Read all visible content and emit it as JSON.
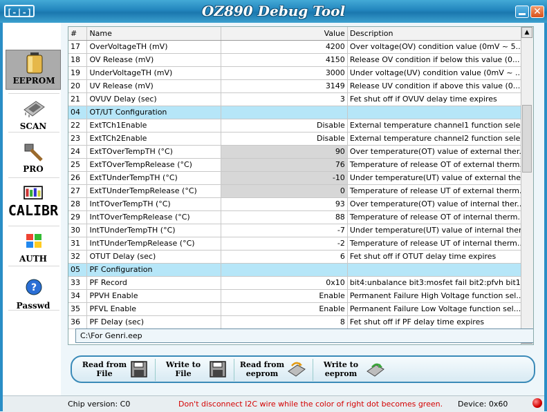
{
  "window": {
    "title": "OZ890 Debug Tool",
    "logo_text": "[-|-]",
    "close_glyph": "✕"
  },
  "sidebar": {
    "items": [
      {
        "label": "EEPROM",
        "icon": "battery-icon",
        "active": true
      },
      {
        "label": "SCAN",
        "icon": "chip-icon",
        "active": false
      },
      {
        "label": "PRO",
        "icon": "hammer-icon",
        "active": false
      },
      {
        "label": "CALIBR",
        "icon": "calibrate-icon",
        "active": false
      },
      {
        "label": "AUTH",
        "icon": "windows-flag-icon",
        "active": false
      },
      {
        "label": "Passwd",
        "icon": "help-icon",
        "active": false
      }
    ]
  },
  "grid": {
    "columns": [
      "#",
      "Name",
      "Value",
      "Description"
    ],
    "rows": [
      {
        "n": "17",
        "name": "OverVoltageTH (mV)",
        "value": "4200",
        "desc": "Over voltage(OV) condition value (0mV ~ 5...",
        "section": false,
        "grey": false
      },
      {
        "n": "18",
        "name": "OV Release (mV)",
        "value": "4150",
        "desc": "Release OV condition if below this value (0...",
        "section": false,
        "grey": false
      },
      {
        "n": "19",
        "name": "UnderVoltageTH (mV)",
        "value": "3000",
        "desc": "Under voltage(UV) condition value (0mV ~ ...",
        "section": false,
        "grey": false
      },
      {
        "n": "20",
        "name": "UV Release (mV)",
        "value": "3149",
        "desc": "Release UV condition if above this value (0...",
        "section": false,
        "grey": false
      },
      {
        "n": "21",
        "name": "OVUV Delay (sec)",
        "value": "3",
        "desc": "Fet shut off if OVUV delay time expires",
        "section": false,
        "grey": false
      },
      {
        "n": "04",
        "name": "OT/UT Configuration",
        "value": "",
        "desc": "",
        "section": true,
        "grey": false
      },
      {
        "n": "22",
        "name": "ExtTCh1Enable",
        "value": "Disable",
        "desc": "External temperature channel1 function sele...",
        "section": false,
        "grey": false
      },
      {
        "n": "23",
        "name": "ExtTCh2Enable",
        "value": "Disable",
        "desc": "External temperature channel2 function sele...",
        "section": false,
        "grey": false
      },
      {
        "n": "24",
        "name": "ExtTOverTempTH (°C)",
        "value": "90",
        "desc": "Over temperature(OT) value of external ther...",
        "section": false,
        "grey": true
      },
      {
        "n": "25",
        "name": "ExtTOverTempRelease (°C)",
        "value": "76",
        "desc": "Temperature of release OT of external therm...",
        "section": false,
        "grey": true
      },
      {
        "n": "26",
        "name": "ExtTUnderTempTH (°C)",
        "value": "-10",
        "desc": "Under temperature(UT) value of external the...",
        "section": false,
        "grey": true
      },
      {
        "n": "27",
        "name": "ExtTUnderTempRelease (°C)",
        "value": "0",
        "desc": "Temperature of release UT of external therm...",
        "section": false,
        "grey": true
      },
      {
        "n": "28",
        "name": "IntTOverTempTH (°C)",
        "value": "93",
        "desc": "Over temperature(OT) value of internal ther...",
        "section": false,
        "grey": false
      },
      {
        "n": "29",
        "name": "IntTOverTempRelease (°C)",
        "value": "88",
        "desc": "Temperature of release OT of internal therm...",
        "section": false,
        "grey": false
      },
      {
        "n": "30",
        "name": "IntTUnderTempTH (°C)",
        "value": "-7",
        "desc": "Under temperature(UT) value of internal ther...",
        "section": false,
        "grey": false
      },
      {
        "n": "31",
        "name": "IntTUnderTempRelease (°C)",
        "value": "-2",
        "desc": "Temperature of release UT of internal therm...",
        "section": false,
        "grey": false
      },
      {
        "n": "32",
        "name": "OTUT Delay (sec)",
        "value": "6",
        "desc": "Fet shut off if OTUT delay time expires",
        "section": false,
        "grey": false
      },
      {
        "n": "05",
        "name": "PF Configuration",
        "value": "",
        "desc": "",
        "section": true,
        "grey": false
      },
      {
        "n": "33",
        "name": "PF Record",
        "value": "0x10",
        "desc": "bit4:unbalance bit3:mosfet fail bit2:pfvh bit1:...",
        "section": false,
        "grey": false
      },
      {
        "n": "34",
        "name": "PPVH Enable",
        "value": "Enable",
        "desc": "Permanent Failure High Voltage function sel...",
        "section": false,
        "grey": false
      },
      {
        "n": "35",
        "name": "PFVL Enable",
        "value": "Enable",
        "desc": "Permanent Failure Low Voltage function sel...",
        "section": false,
        "grey": false
      },
      {
        "n": "36",
        "name": "PF Delay (sec)",
        "value": "8",
        "desc": "Fet shut off if PF delay time expires",
        "section": false,
        "grey": false
      }
    ]
  },
  "file_path": "C:\\For Genri.eep",
  "toolbar": {
    "read_file": "Read from File",
    "write_file": "Write to File",
    "read_eeprom": "Read from eeprom",
    "write_eeprom": "Write to eeprom"
  },
  "status": {
    "chip_version": "Chip version: C0",
    "warning": "Don't disconnect I2C wire while the color of right dot becomes green.",
    "device": "Device: 0x60",
    "dot_color": "#d30000"
  },
  "colors": {
    "section_row": "#b6e6f8",
    "title_bar": "#2285bd"
  }
}
